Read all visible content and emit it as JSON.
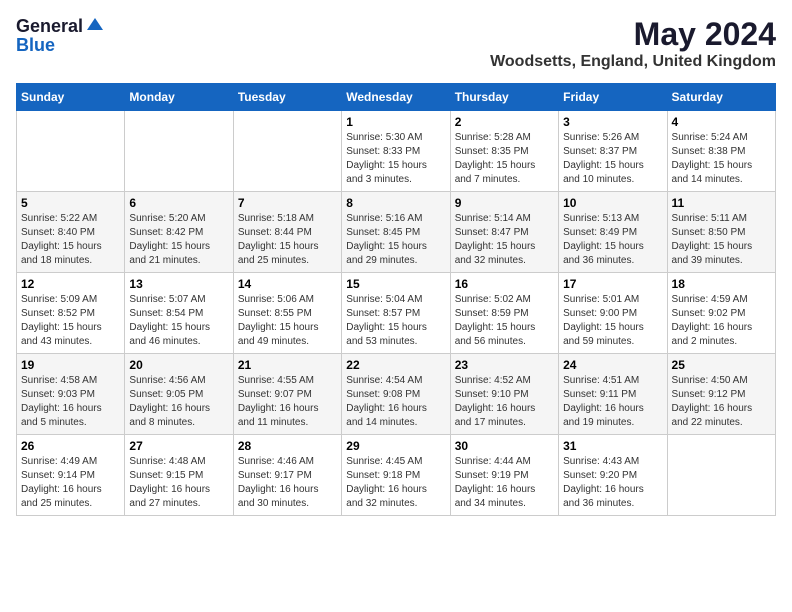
{
  "logo": {
    "general": "General",
    "blue": "Blue"
  },
  "title": {
    "month_year": "May 2024",
    "location": "Woodsetts, England, United Kingdom"
  },
  "header_days": [
    "Sunday",
    "Monday",
    "Tuesday",
    "Wednesday",
    "Thursday",
    "Friday",
    "Saturday"
  ],
  "weeks": [
    [
      {
        "day": "",
        "info": ""
      },
      {
        "day": "",
        "info": ""
      },
      {
        "day": "",
        "info": ""
      },
      {
        "day": "1",
        "info": "Sunrise: 5:30 AM\nSunset: 8:33 PM\nDaylight: 15 hours\nand 3 minutes."
      },
      {
        "day": "2",
        "info": "Sunrise: 5:28 AM\nSunset: 8:35 PM\nDaylight: 15 hours\nand 7 minutes."
      },
      {
        "day": "3",
        "info": "Sunrise: 5:26 AM\nSunset: 8:37 PM\nDaylight: 15 hours\nand 10 minutes."
      },
      {
        "day": "4",
        "info": "Sunrise: 5:24 AM\nSunset: 8:38 PM\nDaylight: 15 hours\nand 14 minutes."
      }
    ],
    [
      {
        "day": "5",
        "info": "Sunrise: 5:22 AM\nSunset: 8:40 PM\nDaylight: 15 hours\nand 18 minutes."
      },
      {
        "day": "6",
        "info": "Sunrise: 5:20 AM\nSunset: 8:42 PM\nDaylight: 15 hours\nand 21 minutes."
      },
      {
        "day": "7",
        "info": "Sunrise: 5:18 AM\nSunset: 8:44 PM\nDaylight: 15 hours\nand 25 minutes."
      },
      {
        "day": "8",
        "info": "Sunrise: 5:16 AM\nSunset: 8:45 PM\nDaylight: 15 hours\nand 29 minutes."
      },
      {
        "day": "9",
        "info": "Sunrise: 5:14 AM\nSunset: 8:47 PM\nDaylight: 15 hours\nand 32 minutes."
      },
      {
        "day": "10",
        "info": "Sunrise: 5:13 AM\nSunset: 8:49 PM\nDaylight: 15 hours\nand 36 minutes."
      },
      {
        "day": "11",
        "info": "Sunrise: 5:11 AM\nSunset: 8:50 PM\nDaylight: 15 hours\nand 39 minutes."
      }
    ],
    [
      {
        "day": "12",
        "info": "Sunrise: 5:09 AM\nSunset: 8:52 PM\nDaylight: 15 hours\nand 43 minutes."
      },
      {
        "day": "13",
        "info": "Sunrise: 5:07 AM\nSunset: 8:54 PM\nDaylight: 15 hours\nand 46 minutes."
      },
      {
        "day": "14",
        "info": "Sunrise: 5:06 AM\nSunset: 8:55 PM\nDaylight: 15 hours\nand 49 minutes."
      },
      {
        "day": "15",
        "info": "Sunrise: 5:04 AM\nSunset: 8:57 PM\nDaylight: 15 hours\nand 53 minutes."
      },
      {
        "day": "16",
        "info": "Sunrise: 5:02 AM\nSunset: 8:59 PM\nDaylight: 15 hours\nand 56 minutes."
      },
      {
        "day": "17",
        "info": "Sunrise: 5:01 AM\nSunset: 9:00 PM\nDaylight: 15 hours\nand 59 minutes."
      },
      {
        "day": "18",
        "info": "Sunrise: 4:59 AM\nSunset: 9:02 PM\nDaylight: 16 hours\nand 2 minutes."
      }
    ],
    [
      {
        "day": "19",
        "info": "Sunrise: 4:58 AM\nSunset: 9:03 PM\nDaylight: 16 hours\nand 5 minutes."
      },
      {
        "day": "20",
        "info": "Sunrise: 4:56 AM\nSunset: 9:05 PM\nDaylight: 16 hours\nand 8 minutes."
      },
      {
        "day": "21",
        "info": "Sunrise: 4:55 AM\nSunset: 9:07 PM\nDaylight: 16 hours\nand 11 minutes."
      },
      {
        "day": "22",
        "info": "Sunrise: 4:54 AM\nSunset: 9:08 PM\nDaylight: 16 hours\nand 14 minutes."
      },
      {
        "day": "23",
        "info": "Sunrise: 4:52 AM\nSunset: 9:10 PM\nDaylight: 16 hours\nand 17 minutes."
      },
      {
        "day": "24",
        "info": "Sunrise: 4:51 AM\nSunset: 9:11 PM\nDaylight: 16 hours\nand 19 minutes."
      },
      {
        "day": "25",
        "info": "Sunrise: 4:50 AM\nSunset: 9:12 PM\nDaylight: 16 hours\nand 22 minutes."
      }
    ],
    [
      {
        "day": "26",
        "info": "Sunrise: 4:49 AM\nSunset: 9:14 PM\nDaylight: 16 hours\nand 25 minutes."
      },
      {
        "day": "27",
        "info": "Sunrise: 4:48 AM\nSunset: 9:15 PM\nDaylight: 16 hours\nand 27 minutes."
      },
      {
        "day": "28",
        "info": "Sunrise: 4:46 AM\nSunset: 9:17 PM\nDaylight: 16 hours\nand 30 minutes."
      },
      {
        "day": "29",
        "info": "Sunrise: 4:45 AM\nSunset: 9:18 PM\nDaylight: 16 hours\nand 32 minutes."
      },
      {
        "day": "30",
        "info": "Sunrise: 4:44 AM\nSunset: 9:19 PM\nDaylight: 16 hours\nand 34 minutes."
      },
      {
        "day": "31",
        "info": "Sunrise: 4:43 AM\nSunset: 9:20 PM\nDaylight: 16 hours\nand 36 minutes."
      },
      {
        "day": "",
        "info": ""
      }
    ]
  ]
}
